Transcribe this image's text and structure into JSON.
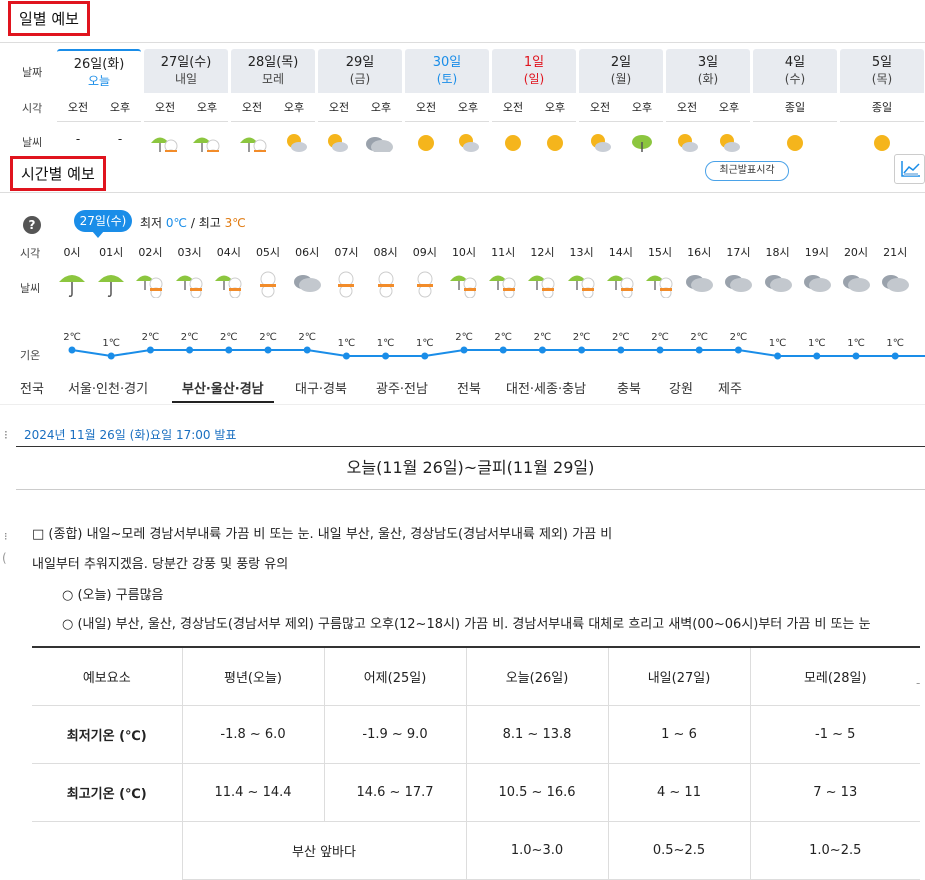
{
  "daily": {
    "title": "일별 예보",
    "row_labels": {
      "date": "날짜",
      "time": "시각",
      "weather": "날씨"
    },
    "days": [
      {
        "date": "26일(화)",
        "sub": "오늘",
        "ampm": [
          "오전",
          "오후"
        ],
        "icons": [
          "-",
          "-"
        ],
        "color": "#222",
        "subcolor": "#1a8de8"
      },
      {
        "date": "27일(수)",
        "sub": "내일",
        "ampm": [
          "오전",
          "오후"
        ],
        "icons": [
          "rain-snow-icon",
          "rain-snow-icon"
        ],
        "color": "#222",
        "subcolor": "#444"
      },
      {
        "date": "28일(목)",
        "sub": "모레",
        "ampm": [
          "오전",
          "오후"
        ],
        "icons": [
          "rain-snow-icon",
          "partly-cloudy-icon"
        ],
        "color": "#222",
        "subcolor": "#444"
      },
      {
        "date": "29일",
        "sub": "(금)",
        "ampm": [
          "오전",
          "오후"
        ],
        "icons": [
          "partly-cloudy-icon",
          "cloudy-icon"
        ],
        "color": "#222",
        "subcolor": "#444"
      },
      {
        "date": "30일",
        "sub": "(토)",
        "ampm": [
          "오전",
          "오후"
        ],
        "icons": [
          "sunny-icon",
          "partly-cloudy-icon"
        ],
        "color": "#1a8de8",
        "subcolor": "#1a8de8"
      },
      {
        "date": "1일",
        "sub": "(일)",
        "ampm": [
          "오전",
          "오후"
        ],
        "icons": [
          "sunny-icon",
          "sunny-icon"
        ],
        "color": "#e0141e",
        "subcolor": "#e0141e"
      },
      {
        "date": "2일",
        "sub": "(월)",
        "ampm": [
          "오전",
          "오후"
        ],
        "icons": [
          "partly-cloudy-icon",
          "rain-icon"
        ],
        "color": "#222",
        "subcolor": "#444"
      },
      {
        "date": "3일",
        "sub": "(화)",
        "ampm": [
          "오전",
          "오후"
        ],
        "icons": [
          "partly-cloudy-icon",
          "partly-cloudy-icon"
        ],
        "color": "#222",
        "subcolor": "#444"
      },
      {
        "date": "4일",
        "sub": "(수)",
        "ampm": [
          "종일"
        ],
        "icons": [
          "sunny-icon"
        ],
        "color": "#222",
        "subcolor": "#444"
      },
      {
        "date": "5일",
        "sub": "(목)",
        "ampm": [
          "종일"
        ],
        "icons": [
          "sunny-icon"
        ],
        "color": "#222",
        "subcolor": "#444"
      }
    ]
  },
  "hourly": {
    "title": "시간별 예보",
    "recent_button": "최근발표시각",
    "date_badge": "27일(수)",
    "min_label": "최저",
    "min_value": "0℃",
    "separator": "/",
    "max_label": "최고",
    "max_value": "3℃",
    "row_labels": {
      "time": "시각",
      "weather": "날씨",
      "temp": "기온"
    },
    "hours": [
      {
        "time": "0시",
        "icon": "rain-umbrella-icon",
        "temp": 2
      },
      {
        "time": "01시",
        "icon": "rain-umbrella-icon",
        "temp": 1
      },
      {
        "time": "02시",
        "icon": "rain-snow-icon",
        "temp": 2
      },
      {
        "time": "03시",
        "icon": "rain-snow-icon",
        "temp": 2
      },
      {
        "time": "04시",
        "icon": "rain-snow-icon",
        "temp": 2
      },
      {
        "time": "05시",
        "icon": "snowman-icon",
        "temp": 2
      },
      {
        "time": "06시",
        "icon": "cloudy-icon",
        "temp": 2
      },
      {
        "time": "07시",
        "icon": "snowman-icon",
        "temp": 1
      },
      {
        "time": "08시",
        "icon": "snowman-icon",
        "temp": 1
      },
      {
        "time": "09시",
        "icon": "snowman-icon",
        "temp": 1
      },
      {
        "time": "10시",
        "icon": "rain-snow-icon",
        "temp": 2
      },
      {
        "time": "11시",
        "icon": "rain-snow-icon",
        "temp": 2
      },
      {
        "time": "12시",
        "icon": "rain-snow-icon",
        "temp": 2
      },
      {
        "time": "13시",
        "icon": "rain-snow-icon",
        "temp": 2
      },
      {
        "time": "14시",
        "icon": "rain-snow-icon",
        "temp": 2
      },
      {
        "time": "15시",
        "icon": "rain-snow-icon",
        "temp": 2
      },
      {
        "time": "16시",
        "icon": "cloudy-icon",
        "temp": 2
      },
      {
        "time": "17시",
        "icon": "cloudy-icon",
        "temp": 2
      },
      {
        "time": "18시",
        "icon": "cloudy-icon",
        "temp": 1
      },
      {
        "time": "19시",
        "icon": "cloudy-icon",
        "temp": 1
      },
      {
        "time": "20시",
        "icon": "cloudy-icon",
        "temp": 1
      },
      {
        "time": "21시",
        "icon": "cloudy-icon",
        "temp": 1
      }
    ],
    "temp_unit": "℃"
  },
  "region_tabs": {
    "items": [
      "전국",
      "서울·인천·경기",
      "부산·울산·경남",
      "대구·경북",
      "광주·전남",
      "전북",
      "대전·세종·충남",
      "충북",
      "강원",
      "제주"
    ],
    "active": "부산·울산·경남"
  },
  "forecast_text": {
    "published": "2024년 11월 26일 (화)요일 17:00 발표",
    "period_title": "오늘(11월 26일)~글피(11월 29일)",
    "line1": "□ (종합) 내일~모레 경남서부내륙 가끔 비 또는 눈. 내일 부산, 울산, 경상남도(경남서부내륙 제외) 가끔 비",
    "line2": "내일부터 추워지겠음. 당분간 강풍 및 풍랑 유의",
    "line3": "○ (오늘) 구름많음",
    "line4": "○ (내일) 부산, 울산, 경상남도(경남서부 제외) 구름많고 오후(12~18시) 가끔 비. 경남서부내륙 대체로 흐리고 새벽(00~06시)부터 가끔 비 또는 눈"
  },
  "table": {
    "headers": [
      "예보요소",
      "평년(오늘)",
      "어제(25일)",
      "오늘(26일)",
      "내일(27일)",
      "모레(28일)"
    ],
    "rows": [
      [
        "최저기온 (℃)",
        "-1.8 ~ 6.0",
        "-1.9 ~ 9.0",
        "8.1 ~ 13.8",
        "1 ~ 6",
        "-1 ~ 5"
      ],
      [
        "최고기온 (℃)",
        "11.4 ~ 14.4",
        "14.6 ~ 17.7",
        "10.5 ~ 16.6",
        "4 ~ 11",
        "7 ~ 13"
      ]
    ],
    "wave_row": {
      "label": "부산 앞바다",
      "values": [
        "1.0~3.0",
        "0.5~2.5",
        "1.0~2.5"
      ]
    }
  },
  "colors": {
    "accent": "#1a8de8",
    "red": "#e0141e",
    "max": "#e07a10"
  }
}
